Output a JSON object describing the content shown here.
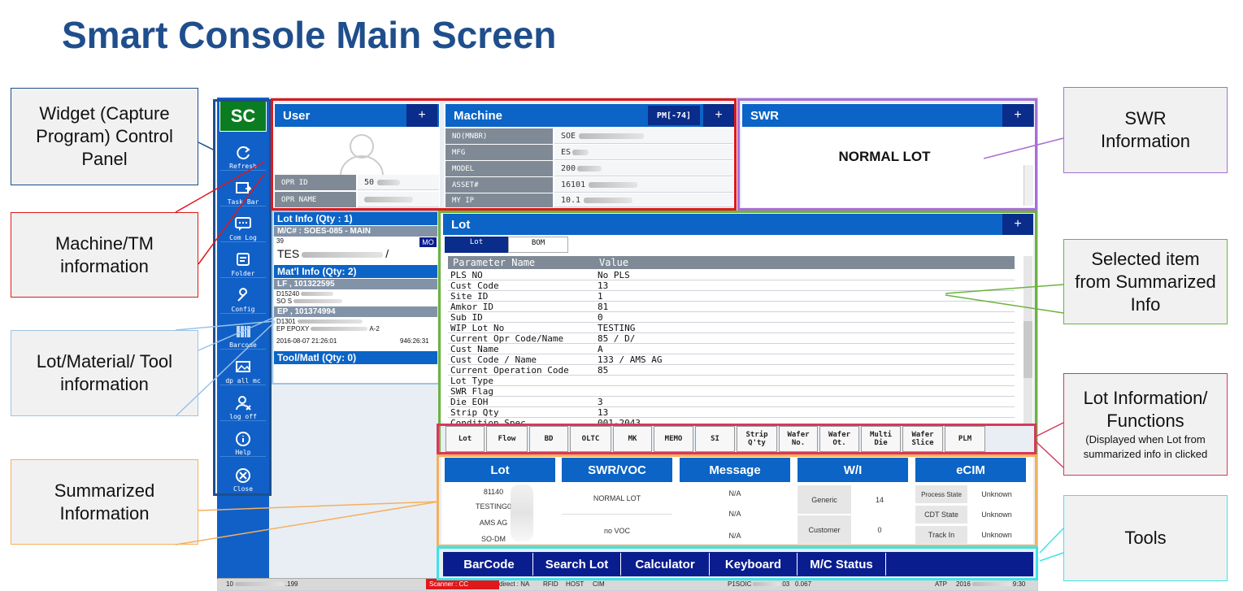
{
  "title": "Smart Console Main Screen",
  "callouts": {
    "widget": "Widget (Capture Program) Control Panel",
    "machine_tm": "Machine/TM information",
    "lot_material": "Lot/Material/ Tool information",
    "summarized": "Summarized Information",
    "swr": "SWR Information",
    "selected_item": "Selected item from Summarized Info",
    "lot_functions": "Lot Information/ Functions",
    "lot_functions_note": "(Displayed when Lot from summarized info in clicked",
    "tools": "Tools"
  },
  "sidebar": {
    "logo": "SC",
    "items": [
      {
        "label": "Refresh",
        "icon": "refresh-icon"
      },
      {
        "label": "Task Bar",
        "icon": "taskbar-icon"
      },
      {
        "label": "Com Log",
        "icon": "comlog-icon"
      },
      {
        "label": "Folder",
        "icon": "folder-icon"
      },
      {
        "label": "Config",
        "icon": "wrench-icon"
      },
      {
        "label": "Barcode",
        "icon": "barcode-icon"
      },
      {
        "label": "dp all mc",
        "icon": "gallery-icon"
      },
      {
        "label": "log off",
        "icon": "user-off-icon"
      },
      {
        "label": "Help",
        "icon": "info-icon"
      },
      {
        "label": "Close",
        "icon": "close-icon"
      }
    ]
  },
  "user_panel": {
    "title": "User",
    "plus": "+",
    "opr_id_label": "OPR ID",
    "opr_id_value": "50",
    "opr_name_label": "OPR NAME"
  },
  "machine_panel": {
    "title": "Machine",
    "pm": "PM[-74]",
    "plus": "+",
    "rows": [
      {
        "label": "NO(MNBR)",
        "value": "SOE"
      },
      {
        "label": "MFG",
        "value": "ES"
      },
      {
        "label": "MODEL",
        "value": "200"
      },
      {
        "label": "ASSET#",
        "value": "16101"
      },
      {
        "label": "MY IP",
        "value": "10.1"
      }
    ]
  },
  "swr_panel": {
    "title": "SWR",
    "plus": "+",
    "status": "NORMAL LOT"
  },
  "lot_info": {
    "header": "Lot Info (Qty : 1)",
    "mc": "M/C# : SOES-085 - MAIN",
    "mc_sub": "39",
    "mo_badge": "MO",
    "lot_text": "TES",
    "lot_suffix": "/",
    "matl_header": "Mat'l Info (Qty:  2)",
    "lf": "LF , 101322595",
    "lf_line1": "D15240",
    "lf_line2": "SO S",
    "ep": "EP , 101374994",
    "ep_line1": "D1301",
    "ep_line2": "EP EPOXY",
    "ep_line2_suffix": "A-2",
    "ep_date": "2016-08-07 21:26:01",
    "ep_time": "946:26:31",
    "tool_header": "Tool/Matl  (Qty: 0)"
  },
  "lot_panel": {
    "title": "Lot",
    "plus": "+",
    "tabs": [
      "Lot",
      "BOM"
    ],
    "col_param": "Parameter Name",
    "col_value": "Value",
    "rows": [
      {
        "param": "PLS NO",
        "value": "No PLS"
      },
      {
        "param": "Cust Code",
        "value": "13"
      },
      {
        "param": "Site ID",
        "value": "1"
      },
      {
        "param": "Amkor ID",
        "value": "81"
      },
      {
        "param": "Sub ID",
        "value": "0"
      },
      {
        "param": "WIP Lot No",
        "value": "TESTING"
      },
      {
        "param": "Current Opr Code/Name",
        "value": "85 / D/"
      },
      {
        "param": "Cust Name",
        "value": "A"
      },
      {
        "param": "Cust Code / Name",
        "value": "133 / AMS AG"
      },
      {
        "param": "Current Operation Code",
        "value": "85"
      },
      {
        "param": "Lot Type",
        "value": ""
      },
      {
        "param": "SWR Flag",
        "value": ""
      },
      {
        "param": "Die EOH",
        "value": "3"
      },
      {
        "param": "Strip Qty",
        "value": "13"
      },
      {
        "param": "Condition Spec",
        "value": "001-2043"
      }
    ]
  },
  "lot_buttons": [
    "Lot",
    "Flow",
    "BD",
    "OLTC",
    "MK",
    "MEMO",
    "SI",
    "Strip Q'ty",
    "Wafer No.",
    "Wafer Ot.",
    "Multi Die",
    "Wafer Slice",
    "PLM"
  ],
  "summary": {
    "lot": {
      "title": "Lot",
      "lines": [
        "81140",
        "TESTING0",
        "AMS AG",
        "SO-DM"
      ]
    },
    "swr_voc": {
      "title": "SWR/VOC",
      "lines": [
        "NORMAL LOT",
        "no VOC"
      ]
    },
    "message": {
      "title": "Message",
      "lines": [
        "N/A",
        "N/A",
        "N/A"
      ]
    },
    "wi": {
      "title": "W/I",
      "rows": [
        {
          "label": "Generic",
          "value": "14"
        },
        {
          "label": "Customer",
          "value": "0"
        }
      ]
    },
    "ecim": {
      "title": "eCIM",
      "rows": [
        {
          "label": "Process State",
          "value": "Unknown"
        },
        {
          "label": "CDT State",
          "value": "Unknown"
        },
        {
          "label": "Track In",
          "value": "Unknown"
        }
      ]
    }
  },
  "tools": [
    "BarCode",
    "Search Lot",
    "Calculator",
    "Keyboard",
    "M/C Status"
  ],
  "status_bar": {
    "ip": "10",
    "ip_suffix": ".199",
    "scanner": "Scanner : CC",
    "direct": "direct : NA",
    "rfid": "RFID",
    "host": "HOST",
    "cim": "CIM",
    "machine": "P1SOIC",
    "machine_suffix": "03",
    "value": "0.067",
    "atp": "ATP",
    "date": "2016",
    "time": "9:30"
  },
  "colors": {
    "title": "#1f4e8c",
    "panel_blue": "#0b64c6",
    "dark_blue": "#0a1d8f",
    "red_box": "#e0181b",
    "purple_box": "#a86ed8",
    "green_box": "#6db33f",
    "orange_box": "#f4b15c",
    "cyan_box": "#3fe3e8",
    "lightblue_box": "#9cc3e8",
    "navy_box": "#1f4e8c",
    "pink_box": "#d8385a"
  }
}
